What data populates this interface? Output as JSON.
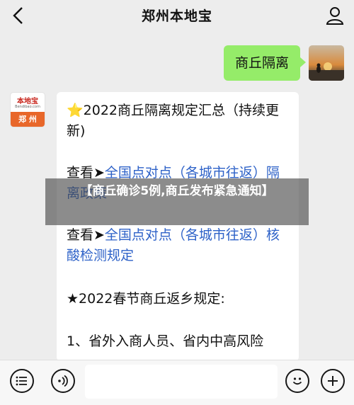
{
  "header": {
    "title": "郑州本地宝",
    "back_icon": "chevron-left-icon",
    "profile_icon": "person-icon"
  },
  "messages": {
    "outgoing": {
      "text": "商丘隔离"
    },
    "bot_avatar": {
      "brand": "本地宝",
      "url": "Bendibao.com",
      "city": "郑 州"
    },
    "incoming": {
      "line1_star": "⭐",
      "line1": "2022商丘隔离规定汇总（持续更新)",
      "line2_prefix": "查看➤",
      "line2_link": "全国点对点（各城市往返）隔离政策",
      "line3_prefix": "查看➤",
      "line3_link": "全国点对点（各城市往返）",
      "line3_tail": "核酸检测规定",
      "line4": "★2022春节商丘返乡规定:",
      "line5": "1、省外入商人员、省内中高风险"
    }
  },
  "overlay": {
    "text": "【商丘确诊5例,商丘发布紧急通知】"
  },
  "bottom": {
    "menu_icon": "menu-list-icon",
    "voice_icon": "voice-icon",
    "input_value": "",
    "emoji_icon": "smiley-icon",
    "plus_icon": "plus-icon"
  },
  "colors": {
    "background": "#ededed",
    "outgoing_bubble": "#95ec69",
    "link": "#2e62c8",
    "brand_orange": "#e8672a"
  }
}
